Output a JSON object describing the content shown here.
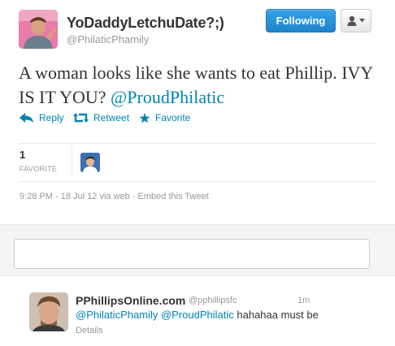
{
  "tweet": {
    "author": {
      "name": "YoDaddyLetchuDate?;)",
      "handle": "@PhilaticPhamily"
    },
    "follow_button_label": "Following",
    "text_plain": "A woman looks like she wants to eat Phillip. IVY IS IT YOU?",
    "text_mention": "@ProudPhilatic",
    "actions": {
      "reply": "Reply",
      "retweet": "Retweet",
      "favorite": "Favorite"
    },
    "stats": {
      "favorites_count": "1",
      "favorites_label": "FAVORITE"
    },
    "meta": {
      "timestamp": "9:28 PM - 18 Jul 12",
      "via": "via web",
      "separator": "·",
      "embed_label": "Embed this Tweet"
    }
  },
  "reply_box": {
    "placeholder": ""
  },
  "reply_tweet": {
    "name": "PPhillipsOnline.com",
    "handle": "@pphillipsfc",
    "time": "1m",
    "mention_1": "@PhilaticPhamily",
    "mention_2": "@ProudPhilatic",
    "text": "hahahaa must be",
    "details_label": "Details"
  },
  "colors": {
    "link": "#0084b4",
    "follow_button": "#2b95dc",
    "muted_text": "#999999",
    "body_text": "#333333"
  },
  "icons": [
    "user-icon",
    "caret-down-icon",
    "reply-icon",
    "retweet-icon",
    "star-icon"
  ]
}
